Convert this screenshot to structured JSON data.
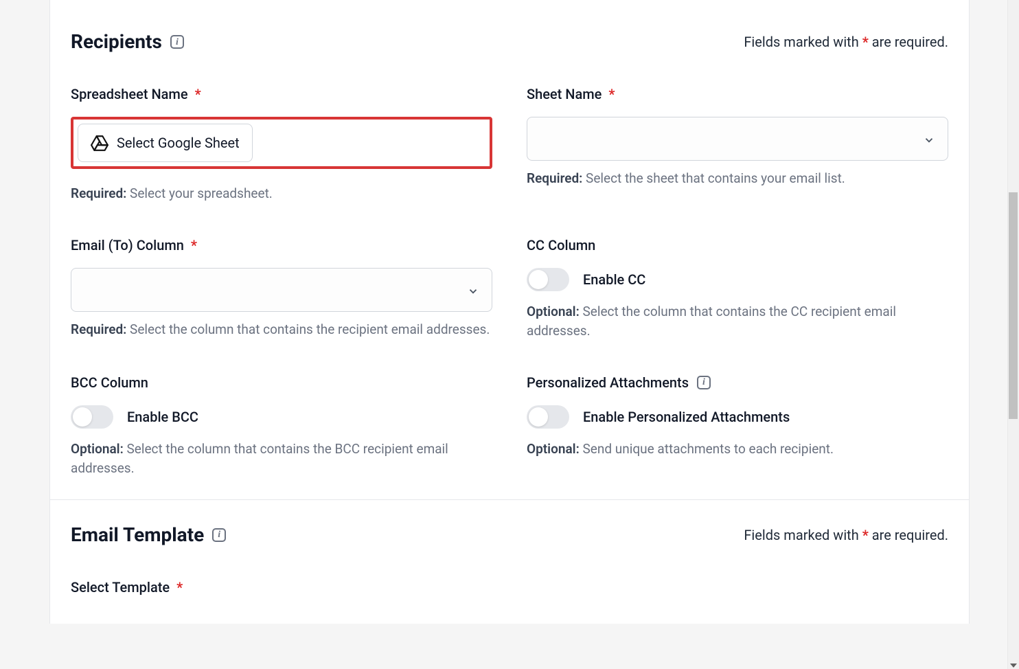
{
  "recipients": {
    "title": "Recipients",
    "requiredNote_pre": "Fields marked with ",
    "requiredNote_post": " are required.",
    "spreadsheet": {
      "label": "Spreadsheet Name",
      "button": "Select Google Sheet",
      "helperPrefix": "Required:",
      "helperText": " Select your spreadsheet."
    },
    "sheetName": {
      "label": "Sheet Name",
      "helperPrefix": "Required:",
      "helperText": " Select the sheet that contains your email list."
    },
    "emailColumn": {
      "label": "Email (To) Column",
      "helperPrefix": "Required:",
      "helperText": " Select the column that contains the recipient email addresses."
    },
    "ccColumn": {
      "label": "CC Column",
      "toggleLabel": "Enable CC",
      "helperPrefix": "Optional:",
      "helperText": " Select the column that contains the CC recipient email addresses."
    },
    "bccColumn": {
      "label": "BCC Column",
      "toggleLabel": "Enable BCC",
      "helperPrefix": "Optional:",
      "helperText": " Select the column that contains the BCC recipient email addresses."
    },
    "attachments": {
      "label": "Personalized Attachments",
      "toggleLabel": "Enable Personalized Attachments",
      "helperPrefix": "Optional:",
      "helperText": " Send unique attachments to each recipient."
    }
  },
  "emailTemplate": {
    "title": "Email Template",
    "requiredNote_pre": "Fields marked with ",
    "requiredNote_post": " are required.",
    "selectTemplate": {
      "label": "Select Template"
    }
  }
}
